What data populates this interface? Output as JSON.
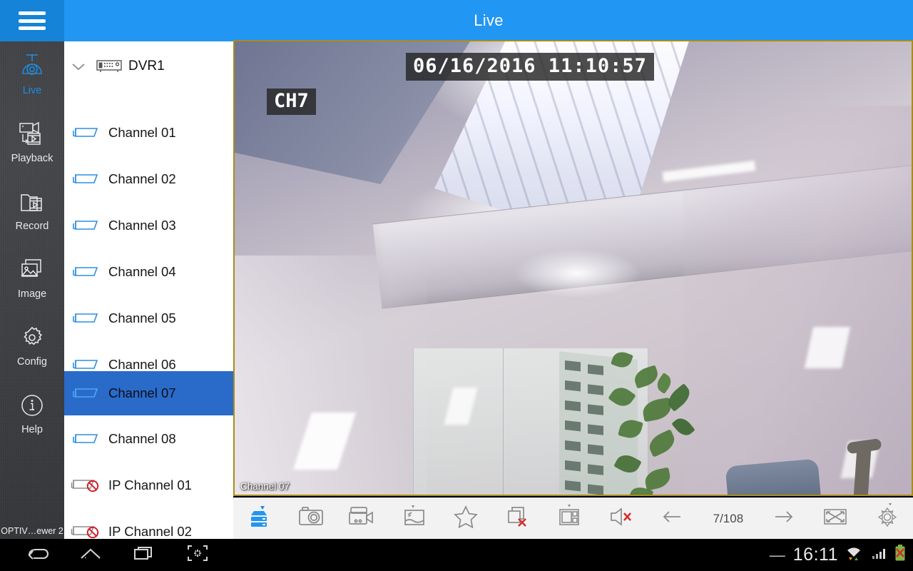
{
  "topbar": {
    "menu_icon": "hamburger-menu-icon",
    "title": "Live"
  },
  "leftnav": {
    "app_name": "OPTIV…ewer 2",
    "items": [
      {
        "label": "Live",
        "icon": "dome-camera-icon",
        "active": true
      },
      {
        "label": "Playback",
        "icon": "playback-film-icon",
        "active": false
      },
      {
        "label": "Record",
        "icon": "record-folder-icon",
        "active": false
      },
      {
        "label": "Image",
        "icon": "image-stack-icon",
        "active": false
      },
      {
        "label": "Config",
        "icon": "gear-icon",
        "active": false
      },
      {
        "label": "Help",
        "icon": "info-circle-icon",
        "active": false
      }
    ]
  },
  "device_tree": {
    "device": {
      "name": "DVR1",
      "icon": "dvr-device-icon",
      "expanded": true,
      "chevron": "chevron-down-icon"
    },
    "channels": [
      {
        "label": "Channel 01",
        "icon": "analog-camera-icon",
        "selected": false,
        "disabled": false
      },
      {
        "label": "Channel 02",
        "icon": "analog-camera-icon",
        "selected": false,
        "disabled": false
      },
      {
        "label": "Channel 03",
        "icon": "analog-camera-icon",
        "selected": false,
        "disabled": false
      },
      {
        "label": "Channel 04",
        "icon": "analog-camera-icon",
        "selected": false,
        "disabled": false
      },
      {
        "label": "Channel 05",
        "icon": "analog-camera-icon",
        "selected": false,
        "disabled": false
      },
      {
        "label": "Channel 06",
        "icon": "analog-camera-icon",
        "selected": false,
        "disabled": false
      },
      {
        "label": "Channel 07",
        "icon": "analog-camera-icon",
        "selected": true,
        "disabled": false
      },
      {
        "label": "Channel 08",
        "icon": "analog-camera-icon",
        "selected": false,
        "disabled": false
      },
      {
        "label": "IP Channel 01",
        "icon": "ip-camera-disabled-icon",
        "selected": false,
        "disabled": true
      },
      {
        "label": "IP Channel 02",
        "icon": "ip-camera-disabled-icon",
        "selected": false,
        "disabled": true
      }
    ]
  },
  "video": {
    "osd_datetime": "06/16/2016  11:10:57",
    "osd_channel": "CH7",
    "stream_label": "Channel 07",
    "border_color": "#a98c1b"
  },
  "toolbar": {
    "buttons": [
      {
        "name": "stream-quality-button",
        "icon": "server-stack-icon",
        "active": true
      },
      {
        "name": "snapshot-button",
        "icon": "camera-icon",
        "active": false
      },
      {
        "name": "record-button",
        "icon": "video-camera-icon",
        "active": false
      },
      {
        "name": "image-settings-button",
        "icon": "picture-icon",
        "active": false
      },
      {
        "name": "favorite-button",
        "icon": "star-icon",
        "active": false
      },
      {
        "name": "close-all-button",
        "icon": "close-windows-icon",
        "active": false
      },
      {
        "name": "layout-button",
        "icon": "grid-layout-icon",
        "active": false
      },
      {
        "name": "mute-button",
        "icon": "speaker-muted-icon",
        "active": false
      }
    ],
    "prev_icon": "arrow-left-icon",
    "page_indicator": "7/108",
    "next_icon": "arrow-right-icon",
    "fullscreen_icon": "fullscreen-expand-icon",
    "ptz_icon": "ptz-control-icon"
  },
  "android_navbar": {
    "back_icon": "back-arrow-icon",
    "home_icon": "home-icon",
    "recents_icon": "recent-apps-icon",
    "screenshot_icon": "screenshot-capture-icon",
    "dash": "—",
    "clock": "16:11",
    "wifi_icon": "wifi-signal-icon",
    "cellular_icon": "cellular-signal-icon",
    "battery_icon": "battery-error-icon"
  },
  "colors": {
    "accent_blue": "#2196f3",
    "menu_blue": "#1583d7",
    "selected_row": "#2a6bc9",
    "nav_dark": "#3a3c40",
    "channel_icon": "#2f8fe0",
    "disabled_red": "#d0202a"
  }
}
